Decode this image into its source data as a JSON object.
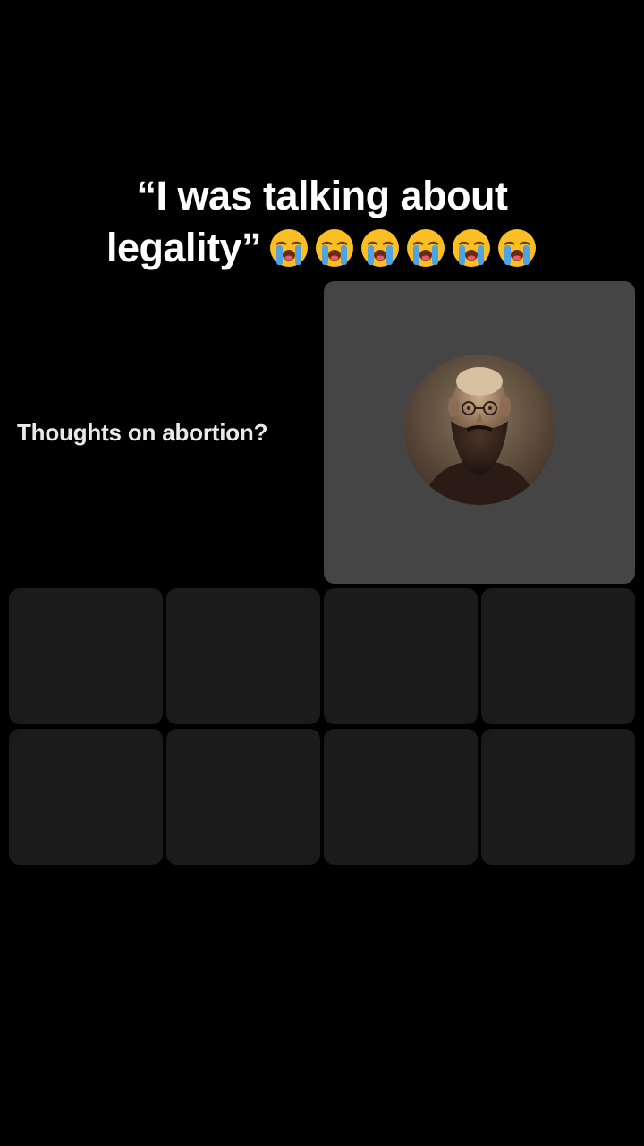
{
  "caption": {
    "line1": "“I was talking about",
    "line2": "legality”",
    "emoji": [
      "loudly-crying-face",
      "loudly-crying-face",
      "loudly-crying-face",
      "loudly-crying-face",
      "loudly-crying-face",
      "loudly-crying-face"
    ]
  },
  "left_panel": {
    "question": "Thoughts on abortion?"
  },
  "featured": {
    "avatar": "bearded-man-portrait",
    "background_color": "#454545"
  },
  "grid": {
    "tile_count": 8,
    "tile_color": "#1b1b1b"
  }
}
